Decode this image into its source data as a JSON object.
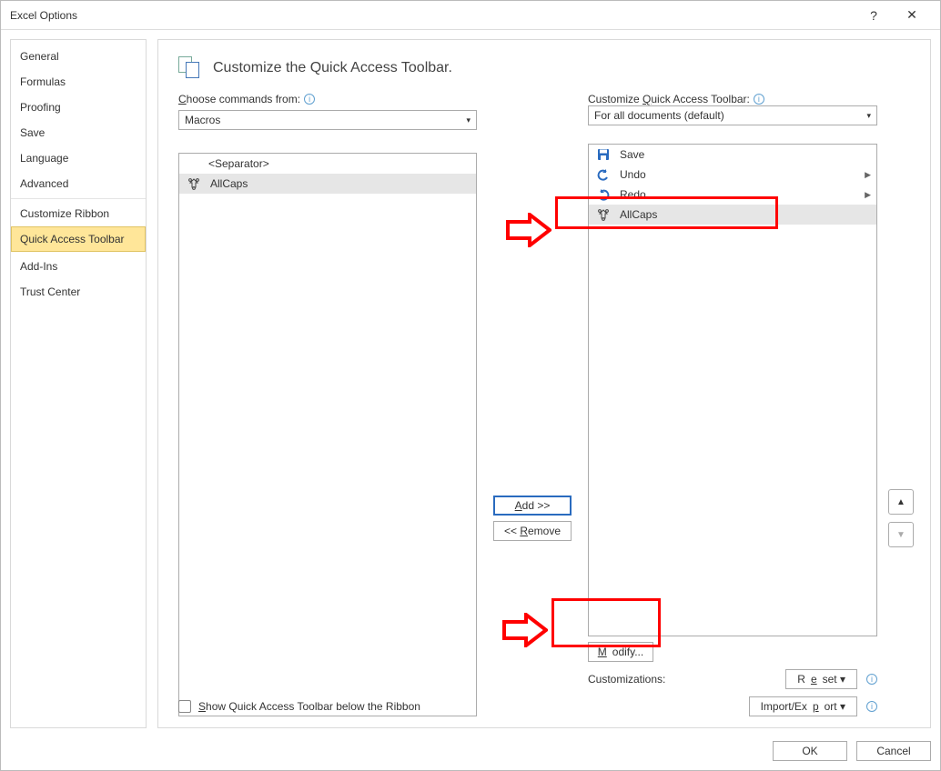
{
  "window": {
    "title": "Excel Options"
  },
  "sidebar": {
    "items": [
      {
        "label": "General"
      },
      {
        "label": "Formulas"
      },
      {
        "label": "Proofing"
      },
      {
        "label": "Save"
      },
      {
        "label": "Language"
      },
      {
        "label": "Advanced"
      },
      {
        "label": "Customize Ribbon"
      },
      {
        "label": "Quick Access Toolbar"
      },
      {
        "label": "Add-Ins"
      },
      {
        "label": "Trust Center"
      }
    ],
    "selected_index": 7
  },
  "header": "Customize the Quick Access Toolbar.",
  "left_panel": {
    "label": "Choose commands from:",
    "dropdown": "Macros",
    "items": [
      {
        "label": "<Separator>",
        "type": "separator"
      },
      {
        "label": "AllCaps",
        "type": "macro",
        "selected": true
      }
    ]
  },
  "right_panel": {
    "label": "Customize Quick Access Toolbar:",
    "dropdown": "For all documents (default)",
    "items": [
      {
        "label": "Save",
        "icon": "save"
      },
      {
        "label": "Undo",
        "icon": "undo",
        "expandable": true
      },
      {
        "label": "Redo",
        "icon": "redo",
        "expandable": true
      },
      {
        "label": "AllCaps",
        "icon": "macro",
        "selected": true
      }
    ]
  },
  "mid_buttons": {
    "add": "Add >>",
    "remove": "<< Remove"
  },
  "modify_button": "Modify...",
  "customizations_label": "Customizations:",
  "reset_button": "Reset",
  "import_export_button": "Import/Export",
  "show_below_ribbon": "Show Quick Access Toolbar below the Ribbon",
  "footer": {
    "ok": "OK",
    "cancel": "Cancel"
  }
}
